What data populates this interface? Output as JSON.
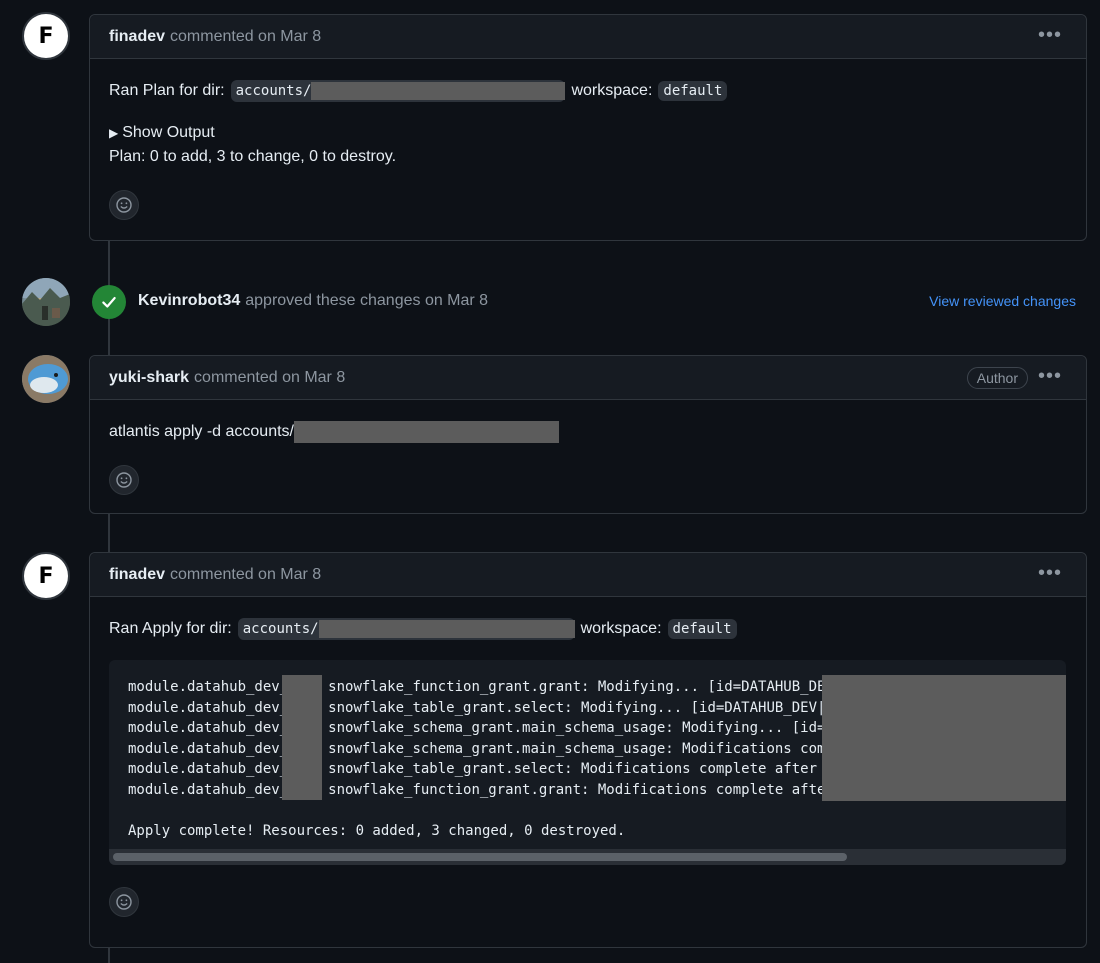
{
  "comments": [
    {
      "author": "finadev",
      "meta": "commented on Mar 8",
      "text_prefix": "Ran Plan for dir:",
      "dir_code": "accounts/",
      "workspace_label": "workspace:",
      "workspace_code": "default",
      "show_output": "Show Output",
      "plan_summary": "Plan: 0 to add, 3 to change, 0 to destroy."
    },
    {
      "author": "yuki-shark",
      "meta": "commented on Mar 8",
      "badge": "Author",
      "text": "atlantis apply -d accounts/"
    },
    {
      "author": "finadev",
      "meta": "commented on Mar 8",
      "text_prefix": "Ran Apply for dir:",
      "dir_code": "accounts/",
      "workspace_label": "workspace:",
      "workspace_code": "default",
      "output_lines": [
        {
          "pre": "module.datahub_dev_",
          "post": "snowflake_function_grant.grant: Modifying... [id=DATAHUB_DE"
        },
        {
          "pre": "module.datahub_dev_",
          "post": "snowflake_table_grant.select: Modifying... [id=DATAHUB_DEV|"
        },
        {
          "pre": "module.datahub_dev_",
          "post": "snowflake_schema_grant.main_schema_usage: Modifying... [id="
        },
        {
          "pre": "module.datahub_dev_",
          "post": "snowflake_schema_grant.main_schema_usage: Modifications com"
        },
        {
          "pre": "module.datahub_dev_",
          "post": "snowflake_table_grant.select: Modifications complete after "
        },
        {
          "pre": "module.datahub_dev_",
          "post": "snowflake_function_grant.grant: Modifications complete afte"
        }
      ],
      "apply_summary": "Apply complete! Resources: 0 added, 3 changed, 0 destroyed."
    }
  ],
  "approval": {
    "author": "Kevinrobot34",
    "text": "approved these changes on Mar 8",
    "link": "View reviewed changes"
  },
  "avatar_letter": "F",
  "colors": {
    "background": "#0d1117",
    "header": "#161b22",
    "border": "#30363d",
    "muted": "#8d96a0",
    "link": "#4493f8",
    "success": "#238636"
  }
}
